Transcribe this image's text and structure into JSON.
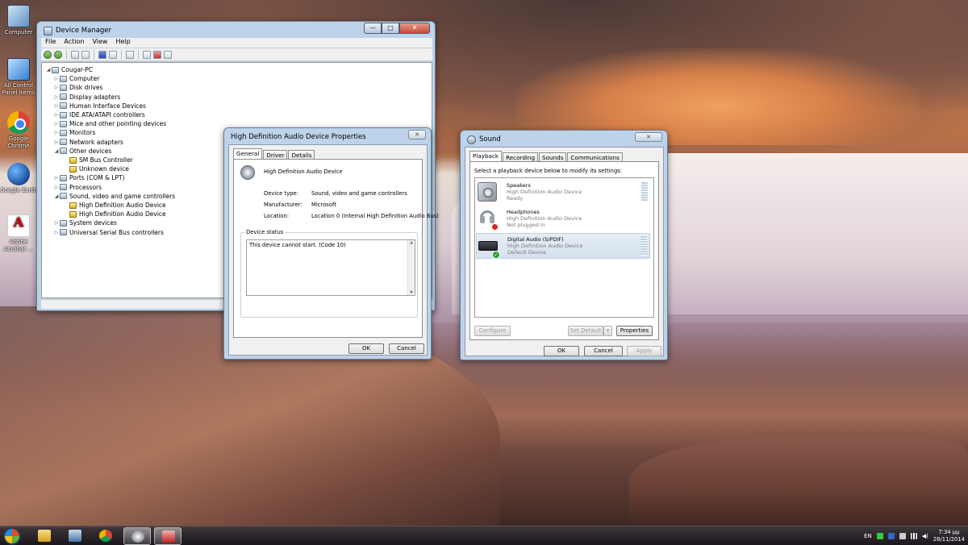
{
  "desktop": {
    "icons": [
      {
        "label": "Computer"
      },
      {
        "label": "All Control Panel Items"
      },
      {
        "label": "Google Chrome"
      },
      {
        "label": "Google Earth"
      },
      {
        "label": "Adobe Acrobat ..."
      }
    ]
  },
  "device_manager": {
    "title": "Device Manager",
    "window_buttons": {
      "minimize": "—",
      "maximize": "□",
      "close": "✕"
    },
    "menu": [
      "File",
      "Action",
      "View",
      "Help"
    ],
    "tree": {
      "root": "Cougar-PC",
      "categories": [
        {
          "label": "Computer",
          "expanded": false
        },
        {
          "label": "Disk drives",
          "expanded": false
        },
        {
          "label": "Display adapters",
          "expanded": false
        },
        {
          "label": "Human Interface Devices",
          "expanded": false
        },
        {
          "label": "IDE ATA/ATAPI controllers",
          "expanded": false
        },
        {
          "label": "Mice and other pointing devices",
          "expanded": false
        },
        {
          "label": "Monitors",
          "expanded": false
        },
        {
          "label": "Network adapters",
          "expanded": false
        },
        {
          "label": "Other devices",
          "expanded": true,
          "children": [
            "SM Bus Controller",
            "Unknown device"
          ]
        },
        {
          "label": "Ports (COM & LPT)",
          "expanded": false
        },
        {
          "label": "Processors",
          "expanded": false
        },
        {
          "label": "Sound, video and game controllers",
          "expanded": true,
          "children": [
            "High Definition Audio Device",
            "High Definition Audio Device"
          ]
        },
        {
          "label": "System devices",
          "expanded": false
        },
        {
          "label": "Universal Serial Bus controllers",
          "expanded": false
        }
      ]
    }
  },
  "properties_dialog": {
    "title": "High Definition Audio Device Properties",
    "close_label": "✕",
    "tabs": [
      "General",
      "Driver",
      "Details"
    ],
    "active_tab": "General",
    "device_name": "High Definition Audio Device",
    "fields": [
      {
        "label": "Device type:",
        "value": "Sound, video and game controllers"
      },
      {
        "label": "Manufacturer:",
        "value": "Microsoft"
      },
      {
        "label": "Location:",
        "value": "Location 0 (Internal High Definition Audio Bus)"
      }
    ],
    "status_group_label": "Device status",
    "status_text": "This device cannot start. (Code 10)",
    "ok_label": "OK",
    "cancel_label": "Cancel"
  },
  "sound_dialog": {
    "title": "Sound",
    "close_label": "✕",
    "tabs": [
      "Playback",
      "Recording",
      "Sounds",
      "Communications"
    ],
    "active_tab": "Playback",
    "instruction": "Select a playback device below to modify its settings:",
    "devices": [
      {
        "name": "Speakers",
        "desc": "High Definition Audio Device",
        "status": "Ready"
      },
      {
        "name": "Headphones",
        "desc": "High Definition Audio Device",
        "status": "Not plugged in"
      },
      {
        "name": "Digital Audio (S/PDIF)",
        "desc": "High Definition Audio Device",
        "status": "Default Device"
      }
    ],
    "configure_label": "Configure",
    "set_default_label": "Set Default",
    "properties_label": "Properties",
    "ok_label": "OK",
    "cancel_label": "Cancel",
    "apply_label": "Apply"
  },
  "taskbar": {
    "language": "EN",
    "time": "7:34 μμ",
    "date": "28/11/2014"
  }
}
